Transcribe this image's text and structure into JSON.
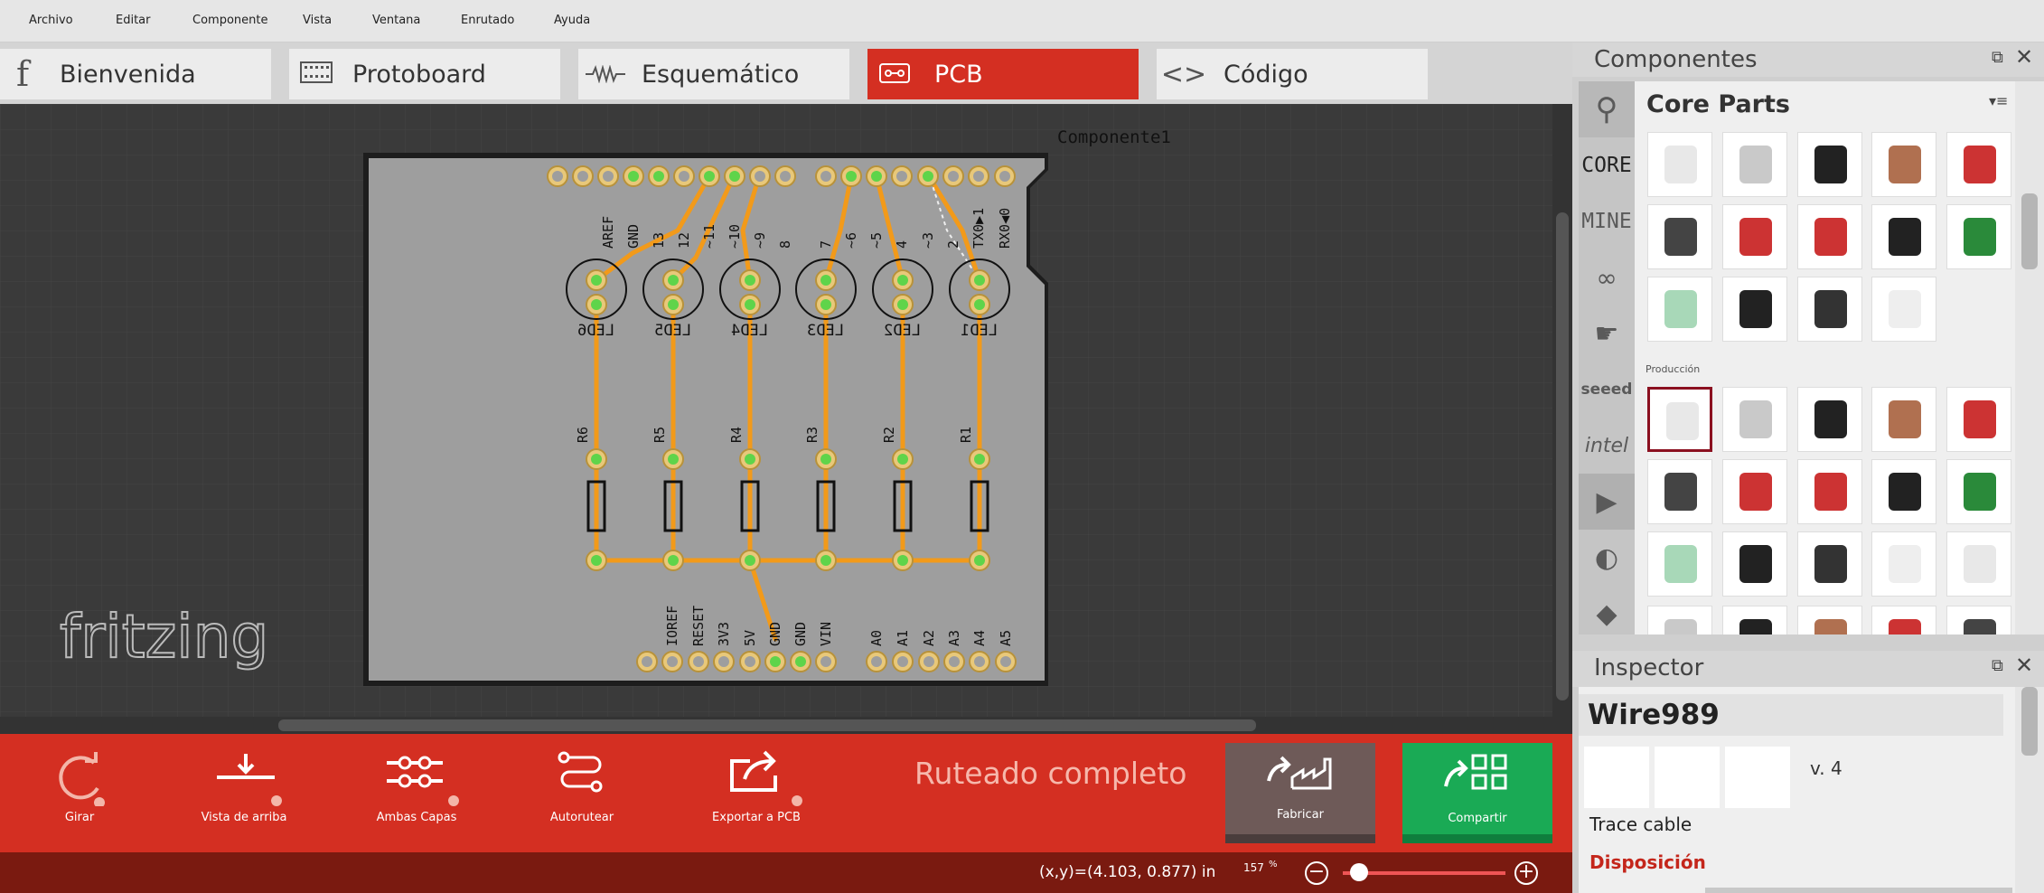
{
  "menu": [
    "Archivo",
    "Editar",
    "Componente",
    "Vista",
    "Ventana",
    "Enrutado",
    "Ayuda"
  ],
  "tabs": [
    {
      "label": "Bienvenida",
      "icon": "f"
    },
    {
      "label": "Protoboard",
      "icon": "breadboard-icon"
    },
    {
      "label": "Esquemático",
      "icon": "schematic-icon"
    },
    {
      "label": "PCB",
      "icon": "pcb-icon"
    },
    {
      "label": "Código",
      "icon": "code-icon"
    }
  ],
  "canvas": {
    "component_label": "Componente1",
    "watermark": "fritzing",
    "header_top_left": [
      "AREF",
      "GND",
      "13",
      "12",
      "~11",
      "~10",
      "~9",
      "8"
    ],
    "header_top_right": [
      "7",
      "~6",
      "~5",
      "4",
      "~3",
      "2",
      "TX0▶1",
      "RX0◀0"
    ],
    "header_bottom_left": [
      "IOREF",
      "RESET",
      "3V3",
      "5V",
      "GND",
      "GND",
      "VIN"
    ],
    "header_bottom_right": [
      "A0",
      "A1",
      "A2",
      "A3",
      "A4",
      "A5"
    ],
    "leds": [
      "LED6",
      "LED5",
      "LED4",
      "LED3",
      "LED2",
      "LED1"
    ],
    "resistors": [
      "R6",
      "R5",
      "R4",
      "R3",
      "R2",
      "R1"
    ]
  },
  "toolbar": {
    "rotate": "Girar",
    "view_top": "Vista de arriba",
    "both_layers": "Ambas Capas",
    "autoroute": "Autorutear",
    "export": "Exportar a PCB",
    "routing_status": "Ruteado completo",
    "fabricate": "Fabricar",
    "share": "Compartir"
  },
  "status": {
    "coords": "(x,y)=(4.103, 0.877) in",
    "zoom": "157",
    "zoom_unit": "%",
    "zoom_level_fraction": 0.1
  },
  "components_panel": {
    "title": "Componentes",
    "bin": "Core Parts",
    "sidebar": [
      "search-icon",
      "CORE",
      "MINE",
      "arduino-icon",
      "fritzing-icon",
      "seeed",
      "intel",
      "play-icon",
      "snap-icon"
    ],
    "section": "Producción"
  },
  "inspector": {
    "title": "Inspector",
    "name": "Wire989",
    "version": "v. 4",
    "type": "Trace cable",
    "section": "Disposición"
  },
  "colors": {
    "accent": "#d42f22",
    "trace": "#f29a1a",
    "share": "#1aaa55",
    "fabricate": "#6e5a58"
  }
}
